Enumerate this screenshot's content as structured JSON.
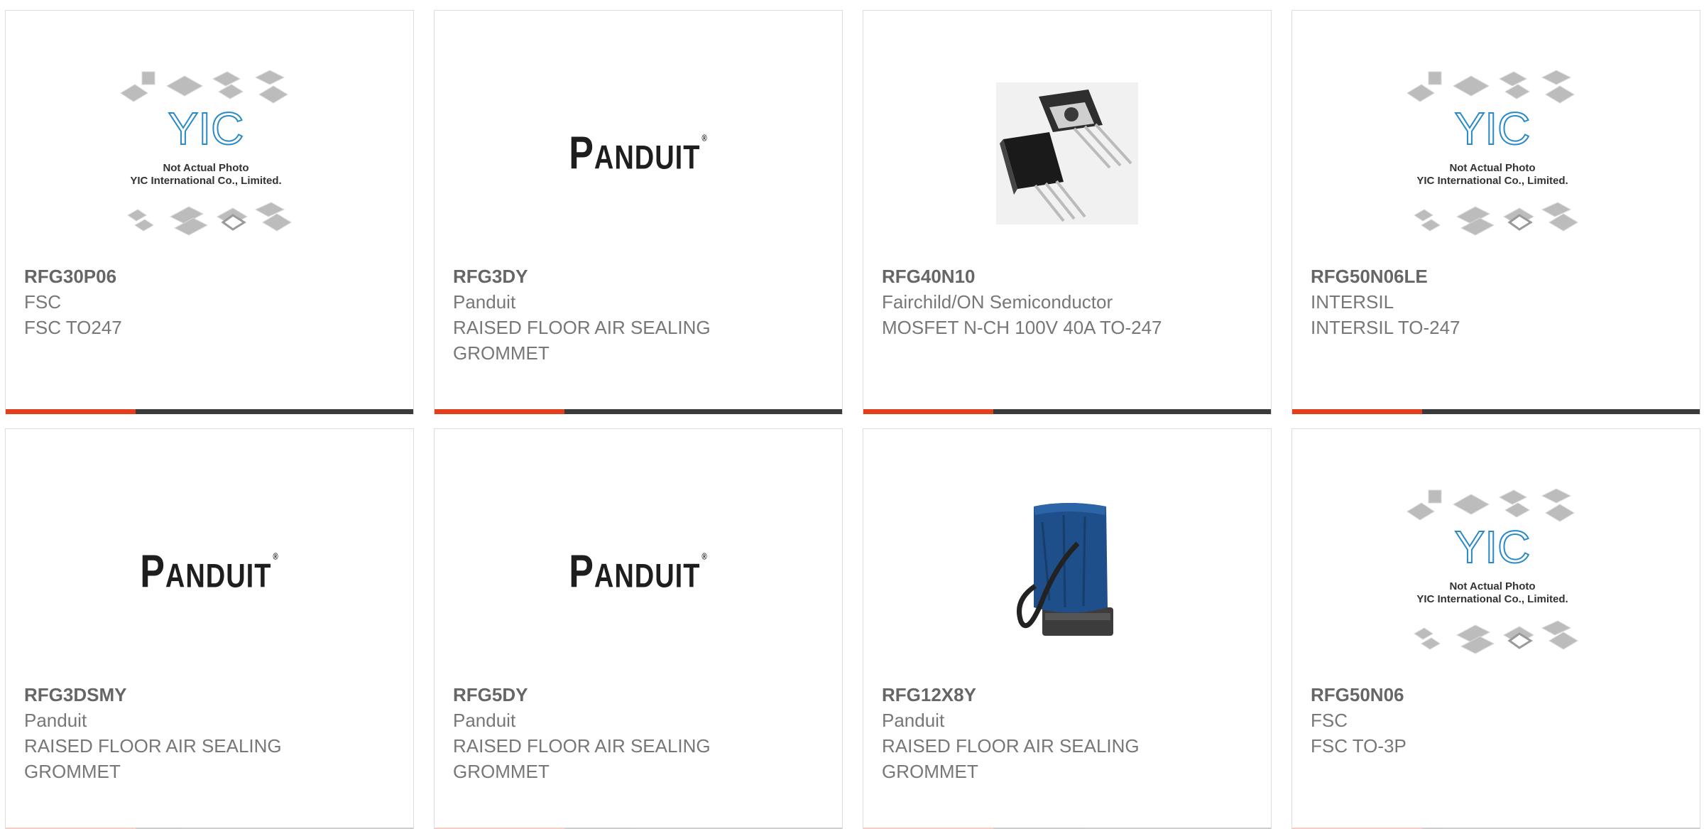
{
  "products": [
    {
      "part": "RFG30P06",
      "manufacturer": "FSC",
      "description": "FSC TO247",
      "image": "yic-placeholder"
    },
    {
      "part": "RFG3DY",
      "manufacturer": "Panduit",
      "description": "RAISED FLOOR AIR SEALING GROMMET",
      "image": "panduit-logo"
    },
    {
      "part": "RFG40N10",
      "manufacturer": "Fairchild/ON Semiconductor",
      "description": "MOSFET N-CH 100V 40A TO-247",
      "image": "to247-transistor"
    },
    {
      "part": "RFG50N06LE",
      "manufacturer": "INTERSIL",
      "description": "INTERSIL TO-247",
      "image": "yic-placeholder"
    },
    {
      "part": "RFG3DSMY",
      "manufacturer": "Panduit",
      "description": "RAISED FLOOR AIR SEALING GROMMET",
      "image": "panduit-logo"
    },
    {
      "part": "RFG5DY",
      "manufacturer": "Panduit",
      "description": "RAISED FLOOR AIR SEALING GROMMET",
      "image": "panduit-logo"
    },
    {
      "part": "RFG12X8Y",
      "manufacturer": "Panduit",
      "description": "RAISED FLOOR AIR SEALING GROMMET",
      "image": "blue-grommet"
    },
    {
      "part": "RFG50N06",
      "manufacturer": "FSC",
      "description": "FSC TO-3P",
      "image": "yic-placeholder"
    }
  ],
  "placeholder": {
    "brand": "YIC",
    "line1": "Not Actual Photo",
    "line2": "YIC International Co., Limited."
  },
  "panduit_logo": {
    "initial": "P",
    "rest": "ANDUIT",
    "mark": "®"
  },
  "colors": {
    "accent": "#e2401c",
    "bar": "#3a3a3a",
    "border": "#dcdcdc",
    "text": "#777777"
  }
}
